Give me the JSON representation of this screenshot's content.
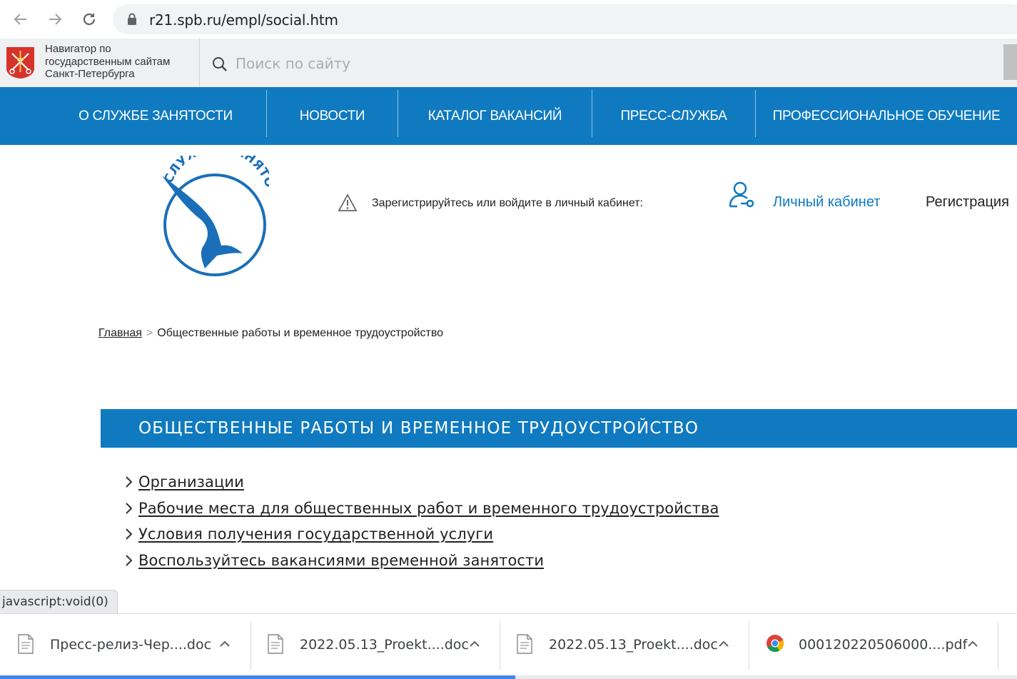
{
  "browser": {
    "url": "r21.spb.ru/empl/social.htm"
  },
  "navigator": {
    "text": "Навигатор по государственным сайтам Санкт-Петербурга",
    "search_placeholder": "Поиск по сайту"
  },
  "menu": {
    "items": [
      {
        "label": "О службе занятости"
      },
      {
        "label": "Новости"
      },
      {
        "label": "Каталог вакансий"
      },
      {
        "label": "Пресс-служба"
      },
      {
        "label": "Профессиональное обучение"
      }
    ]
  },
  "header": {
    "logo_text": "СЛУЖБА ЗАНЯТОСТИ",
    "register_prompt": "Зарегистрируйтесь или войдите в личный кабинет:",
    "cabinet_label": "Личный кабинет",
    "registration_label": "Регистрация"
  },
  "breadcrumb": {
    "home": "Главная",
    "separator": ">",
    "current": "Общественные работы и временное трудоустройство"
  },
  "section": {
    "title": "ОБЩЕСТВЕННЫЕ РАБОТЫ И ВРЕМЕННОЕ ТРУДОУСТРОЙСТВО",
    "links": [
      {
        "label": "Организации"
      },
      {
        "label": "Рабочие места для общественных работ и временного трудоустройства"
      },
      {
        "label": "Условия получения государственной услуги"
      },
      {
        "label": "Воспользуйтесь вакансиями временной занятости"
      }
    ]
  },
  "status_text": "javascript:void(0)",
  "downloads": [
    {
      "name": "Пресс-релиз-Чер....doc",
      "icon": "doc-file-icon"
    },
    {
      "name": "2022.05.13_Proekt....doc",
      "icon": "doc-file-icon"
    },
    {
      "name": "2022.05.13_Proekt....doc",
      "icon": "doc-file-icon"
    },
    {
      "name": "000120220506000....pdf",
      "icon": "chrome-icon"
    }
  ],
  "colors": {
    "brand_blue": "#0f7ac0",
    "navigator_bg": "#eef0f2"
  }
}
